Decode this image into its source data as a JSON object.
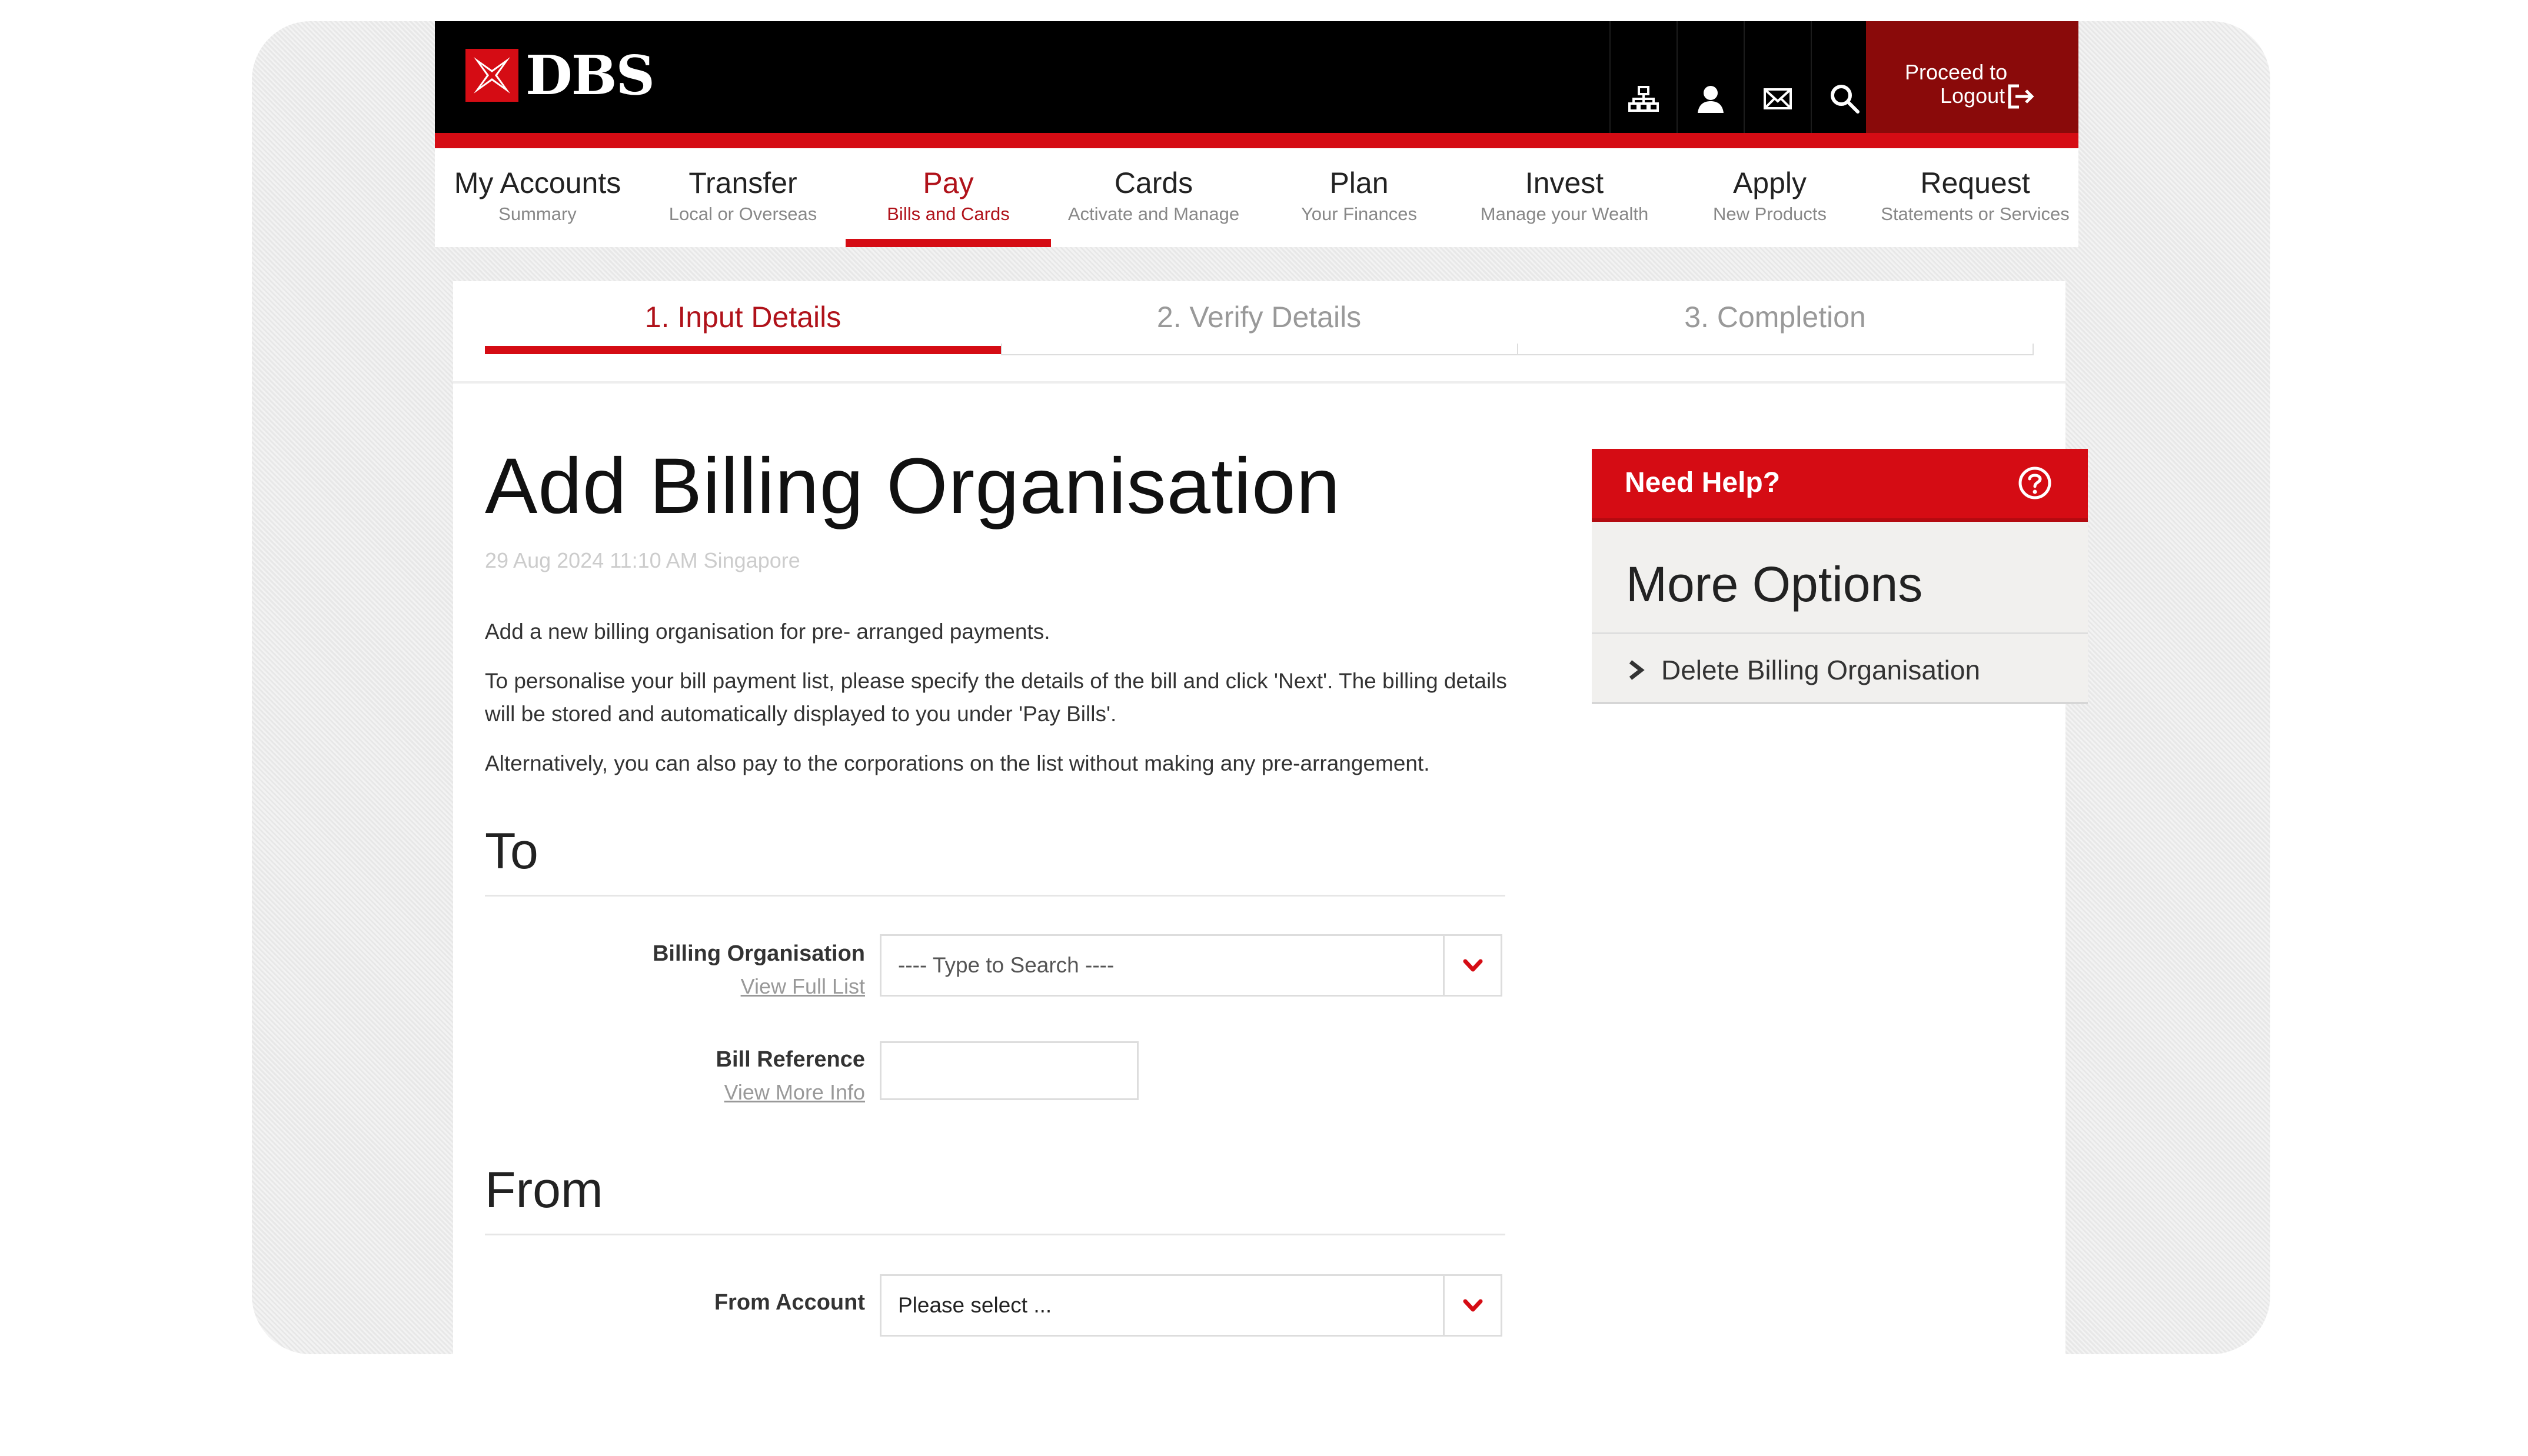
{
  "header": {
    "brand": "DBS",
    "icons": [
      "sitemap-icon",
      "profile-icon",
      "mail-icon",
      "search-icon"
    ],
    "logout_line1": "Proceed to",
    "logout_line2": "Logout"
  },
  "nav": [
    {
      "title": "My Accounts",
      "sub": "Summary"
    },
    {
      "title": "Transfer",
      "sub": "Local or Overseas"
    },
    {
      "title": "Pay",
      "sub": "Bills and Cards",
      "active": true
    },
    {
      "title": "Cards",
      "sub": "Activate and Manage"
    },
    {
      "title": "Plan",
      "sub": "Your Finances"
    },
    {
      "title": "Invest",
      "sub": "Manage your Wealth"
    },
    {
      "title": "Apply",
      "sub": "New Products"
    },
    {
      "title": "Request",
      "sub": "Statements or Services"
    }
  ],
  "steps": [
    "1. Input Details",
    "2. Verify Details",
    "3. Completion"
  ],
  "page": {
    "title": "Add Billing Organisation",
    "timestamp": "29 Aug 2024 11:10 AM Singapore",
    "para1": "Add a new billing organisation for pre- arranged payments.",
    "para2": "To personalise your bill payment list, please specify the details of the bill and click 'Next'. The billing details will be stored and automatically displayed to you under 'Pay Bills'.",
    "para3": "Alternatively, you can also pay to the corporations on the list without making any pre-arrangement."
  },
  "to_section": {
    "heading": "To",
    "billing_org_label": "Billing Organisation",
    "billing_org_link": "View Full List",
    "billing_org_value": "---- Type to Search ----",
    "bill_ref_label": "Bill Reference",
    "bill_ref_link": "View More Info",
    "bill_ref_value": ""
  },
  "from_section": {
    "heading": "From",
    "from_account_label": "From Account",
    "from_account_value": "Please select ..."
  },
  "sidebar": {
    "help_title": "Need Help?",
    "more_title": "More Options",
    "option1": "Delete Billing Organisation"
  },
  "colors": {
    "brand_red": "#d50c14",
    "dark_red": "#8a0a0a",
    "active_text": "#b0121a"
  }
}
